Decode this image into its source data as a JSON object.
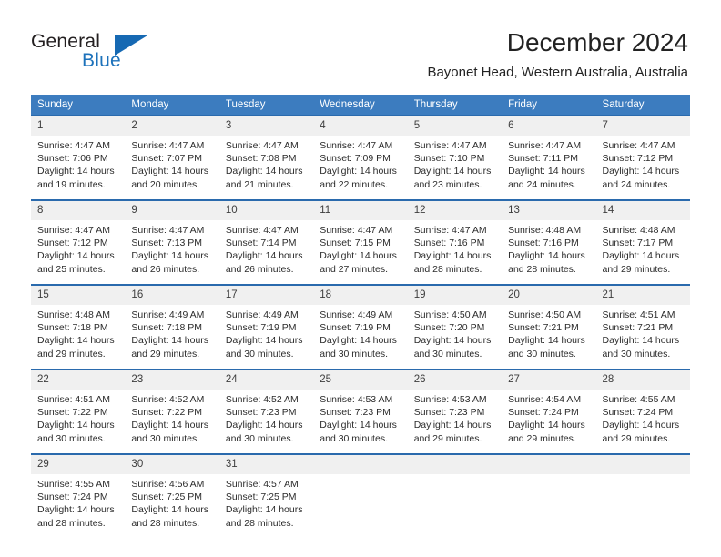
{
  "brand": {
    "name_top": "General",
    "name_bottom": "Blue",
    "triangle_color": "#1669b3",
    "blue_color": "#1d72bb"
  },
  "header": {
    "month_title": "December 2024",
    "location": "Bayonet Head, Western Australia, Australia"
  },
  "colors": {
    "header_row_bg": "#3c7cbf",
    "cell_top_border": "#2a6aad",
    "daynum_bg": "#f0f0f0"
  },
  "weekdays": [
    "Sunday",
    "Monday",
    "Tuesday",
    "Wednesday",
    "Thursday",
    "Friday",
    "Saturday"
  ],
  "labels": {
    "sunrise_prefix": "Sunrise:",
    "sunset_prefix": "Sunset:",
    "daylight_prefix": "Daylight:"
  },
  "weeks": [
    [
      {
        "day": "1",
        "sunrise": "Sunrise: 4:47 AM",
        "sunset": "Sunset: 7:06 PM",
        "daylight1": "Daylight: 14 hours",
        "daylight2": "and 19 minutes."
      },
      {
        "day": "2",
        "sunrise": "Sunrise: 4:47 AM",
        "sunset": "Sunset: 7:07 PM",
        "daylight1": "Daylight: 14 hours",
        "daylight2": "and 20 minutes."
      },
      {
        "day": "3",
        "sunrise": "Sunrise: 4:47 AM",
        "sunset": "Sunset: 7:08 PM",
        "daylight1": "Daylight: 14 hours",
        "daylight2": "and 21 minutes."
      },
      {
        "day": "4",
        "sunrise": "Sunrise: 4:47 AM",
        "sunset": "Sunset: 7:09 PM",
        "daylight1": "Daylight: 14 hours",
        "daylight2": "and 22 minutes."
      },
      {
        "day": "5",
        "sunrise": "Sunrise: 4:47 AM",
        "sunset": "Sunset: 7:10 PM",
        "daylight1": "Daylight: 14 hours",
        "daylight2": "and 23 minutes."
      },
      {
        "day": "6",
        "sunrise": "Sunrise: 4:47 AM",
        "sunset": "Sunset: 7:11 PM",
        "daylight1": "Daylight: 14 hours",
        "daylight2": "and 24 minutes."
      },
      {
        "day": "7",
        "sunrise": "Sunrise: 4:47 AM",
        "sunset": "Sunset: 7:12 PM",
        "daylight1": "Daylight: 14 hours",
        "daylight2": "and 24 minutes."
      }
    ],
    [
      {
        "day": "8",
        "sunrise": "Sunrise: 4:47 AM",
        "sunset": "Sunset: 7:12 PM",
        "daylight1": "Daylight: 14 hours",
        "daylight2": "and 25 minutes."
      },
      {
        "day": "9",
        "sunrise": "Sunrise: 4:47 AM",
        "sunset": "Sunset: 7:13 PM",
        "daylight1": "Daylight: 14 hours",
        "daylight2": "and 26 minutes."
      },
      {
        "day": "10",
        "sunrise": "Sunrise: 4:47 AM",
        "sunset": "Sunset: 7:14 PM",
        "daylight1": "Daylight: 14 hours",
        "daylight2": "and 26 minutes."
      },
      {
        "day": "11",
        "sunrise": "Sunrise: 4:47 AM",
        "sunset": "Sunset: 7:15 PM",
        "daylight1": "Daylight: 14 hours",
        "daylight2": "and 27 minutes."
      },
      {
        "day": "12",
        "sunrise": "Sunrise: 4:47 AM",
        "sunset": "Sunset: 7:16 PM",
        "daylight1": "Daylight: 14 hours",
        "daylight2": "and 28 minutes."
      },
      {
        "day": "13",
        "sunrise": "Sunrise: 4:48 AM",
        "sunset": "Sunset: 7:16 PM",
        "daylight1": "Daylight: 14 hours",
        "daylight2": "and 28 minutes."
      },
      {
        "day": "14",
        "sunrise": "Sunrise: 4:48 AM",
        "sunset": "Sunset: 7:17 PM",
        "daylight1": "Daylight: 14 hours",
        "daylight2": "and 29 minutes."
      }
    ],
    [
      {
        "day": "15",
        "sunrise": "Sunrise: 4:48 AM",
        "sunset": "Sunset: 7:18 PM",
        "daylight1": "Daylight: 14 hours",
        "daylight2": "and 29 minutes."
      },
      {
        "day": "16",
        "sunrise": "Sunrise: 4:49 AM",
        "sunset": "Sunset: 7:18 PM",
        "daylight1": "Daylight: 14 hours",
        "daylight2": "and 29 minutes."
      },
      {
        "day": "17",
        "sunrise": "Sunrise: 4:49 AM",
        "sunset": "Sunset: 7:19 PM",
        "daylight1": "Daylight: 14 hours",
        "daylight2": "and 30 minutes."
      },
      {
        "day": "18",
        "sunrise": "Sunrise: 4:49 AM",
        "sunset": "Sunset: 7:19 PM",
        "daylight1": "Daylight: 14 hours",
        "daylight2": "and 30 minutes."
      },
      {
        "day": "19",
        "sunrise": "Sunrise: 4:50 AM",
        "sunset": "Sunset: 7:20 PM",
        "daylight1": "Daylight: 14 hours",
        "daylight2": "and 30 minutes."
      },
      {
        "day": "20",
        "sunrise": "Sunrise: 4:50 AM",
        "sunset": "Sunset: 7:21 PM",
        "daylight1": "Daylight: 14 hours",
        "daylight2": "and 30 minutes."
      },
      {
        "day": "21",
        "sunrise": "Sunrise: 4:51 AM",
        "sunset": "Sunset: 7:21 PM",
        "daylight1": "Daylight: 14 hours",
        "daylight2": "and 30 minutes."
      }
    ],
    [
      {
        "day": "22",
        "sunrise": "Sunrise: 4:51 AM",
        "sunset": "Sunset: 7:22 PM",
        "daylight1": "Daylight: 14 hours",
        "daylight2": "and 30 minutes."
      },
      {
        "day": "23",
        "sunrise": "Sunrise: 4:52 AM",
        "sunset": "Sunset: 7:22 PM",
        "daylight1": "Daylight: 14 hours",
        "daylight2": "and 30 minutes."
      },
      {
        "day": "24",
        "sunrise": "Sunrise: 4:52 AM",
        "sunset": "Sunset: 7:23 PM",
        "daylight1": "Daylight: 14 hours",
        "daylight2": "and 30 minutes."
      },
      {
        "day": "25",
        "sunrise": "Sunrise: 4:53 AM",
        "sunset": "Sunset: 7:23 PM",
        "daylight1": "Daylight: 14 hours",
        "daylight2": "and 30 minutes."
      },
      {
        "day": "26",
        "sunrise": "Sunrise: 4:53 AM",
        "sunset": "Sunset: 7:23 PM",
        "daylight1": "Daylight: 14 hours",
        "daylight2": "and 29 minutes."
      },
      {
        "day": "27",
        "sunrise": "Sunrise: 4:54 AM",
        "sunset": "Sunset: 7:24 PM",
        "daylight1": "Daylight: 14 hours",
        "daylight2": "and 29 minutes."
      },
      {
        "day": "28",
        "sunrise": "Sunrise: 4:55 AM",
        "sunset": "Sunset: 7:24 PM",
        "daylight1": "Daylight: 14 hours",
        "daylight2": "and 29 minutes."
      }
    ],
    [
      {
        "day": "29",
        "sunrise": "Sunrise: 4:55 AM",
        "sunset": "Sunset: 7:24 PM",
        "daylight1": "Daylight: 14 hours",
        "daylight2": "and 28 minutes."
      },
      {
        "day": "30",
        "sunrise": "Sunrise: 4:56 AM",
        "sunset": "Sunset: 7:25 PM",
        "daylight1": "Daylight: 14 hours",
        "daylight2": "and 28 minutes."
      },
      {
        "day": "31",
        "sunrise": "Sunrise: 4:57 AM",
        "sunset": "Sunset: 7:25 PM",
        "daylight1": "Daylight: 14 hours",
        "daylight2": "and 28 minutes."
      },
      {
        "day": "",
        "sunrise": "",
        "sunset": "",
        "daylight1": "",
        "daylight2": ""
      },
      {
        "day": "",
        "sunrise": "",
        "sunset": "",
        "daylight1": "",
        "daylight2": ""
      },
      {
        "day": "",
        "sunrise": "",
        "sunset": "",
        "daylight1": "",
        "daylight2": ""
      },
      {
        "day": "",
        "sunrise": "",
        "sunset": "",
        "daylight1": "",
        "daylight2": ""
      }
    ]
  ]
}
